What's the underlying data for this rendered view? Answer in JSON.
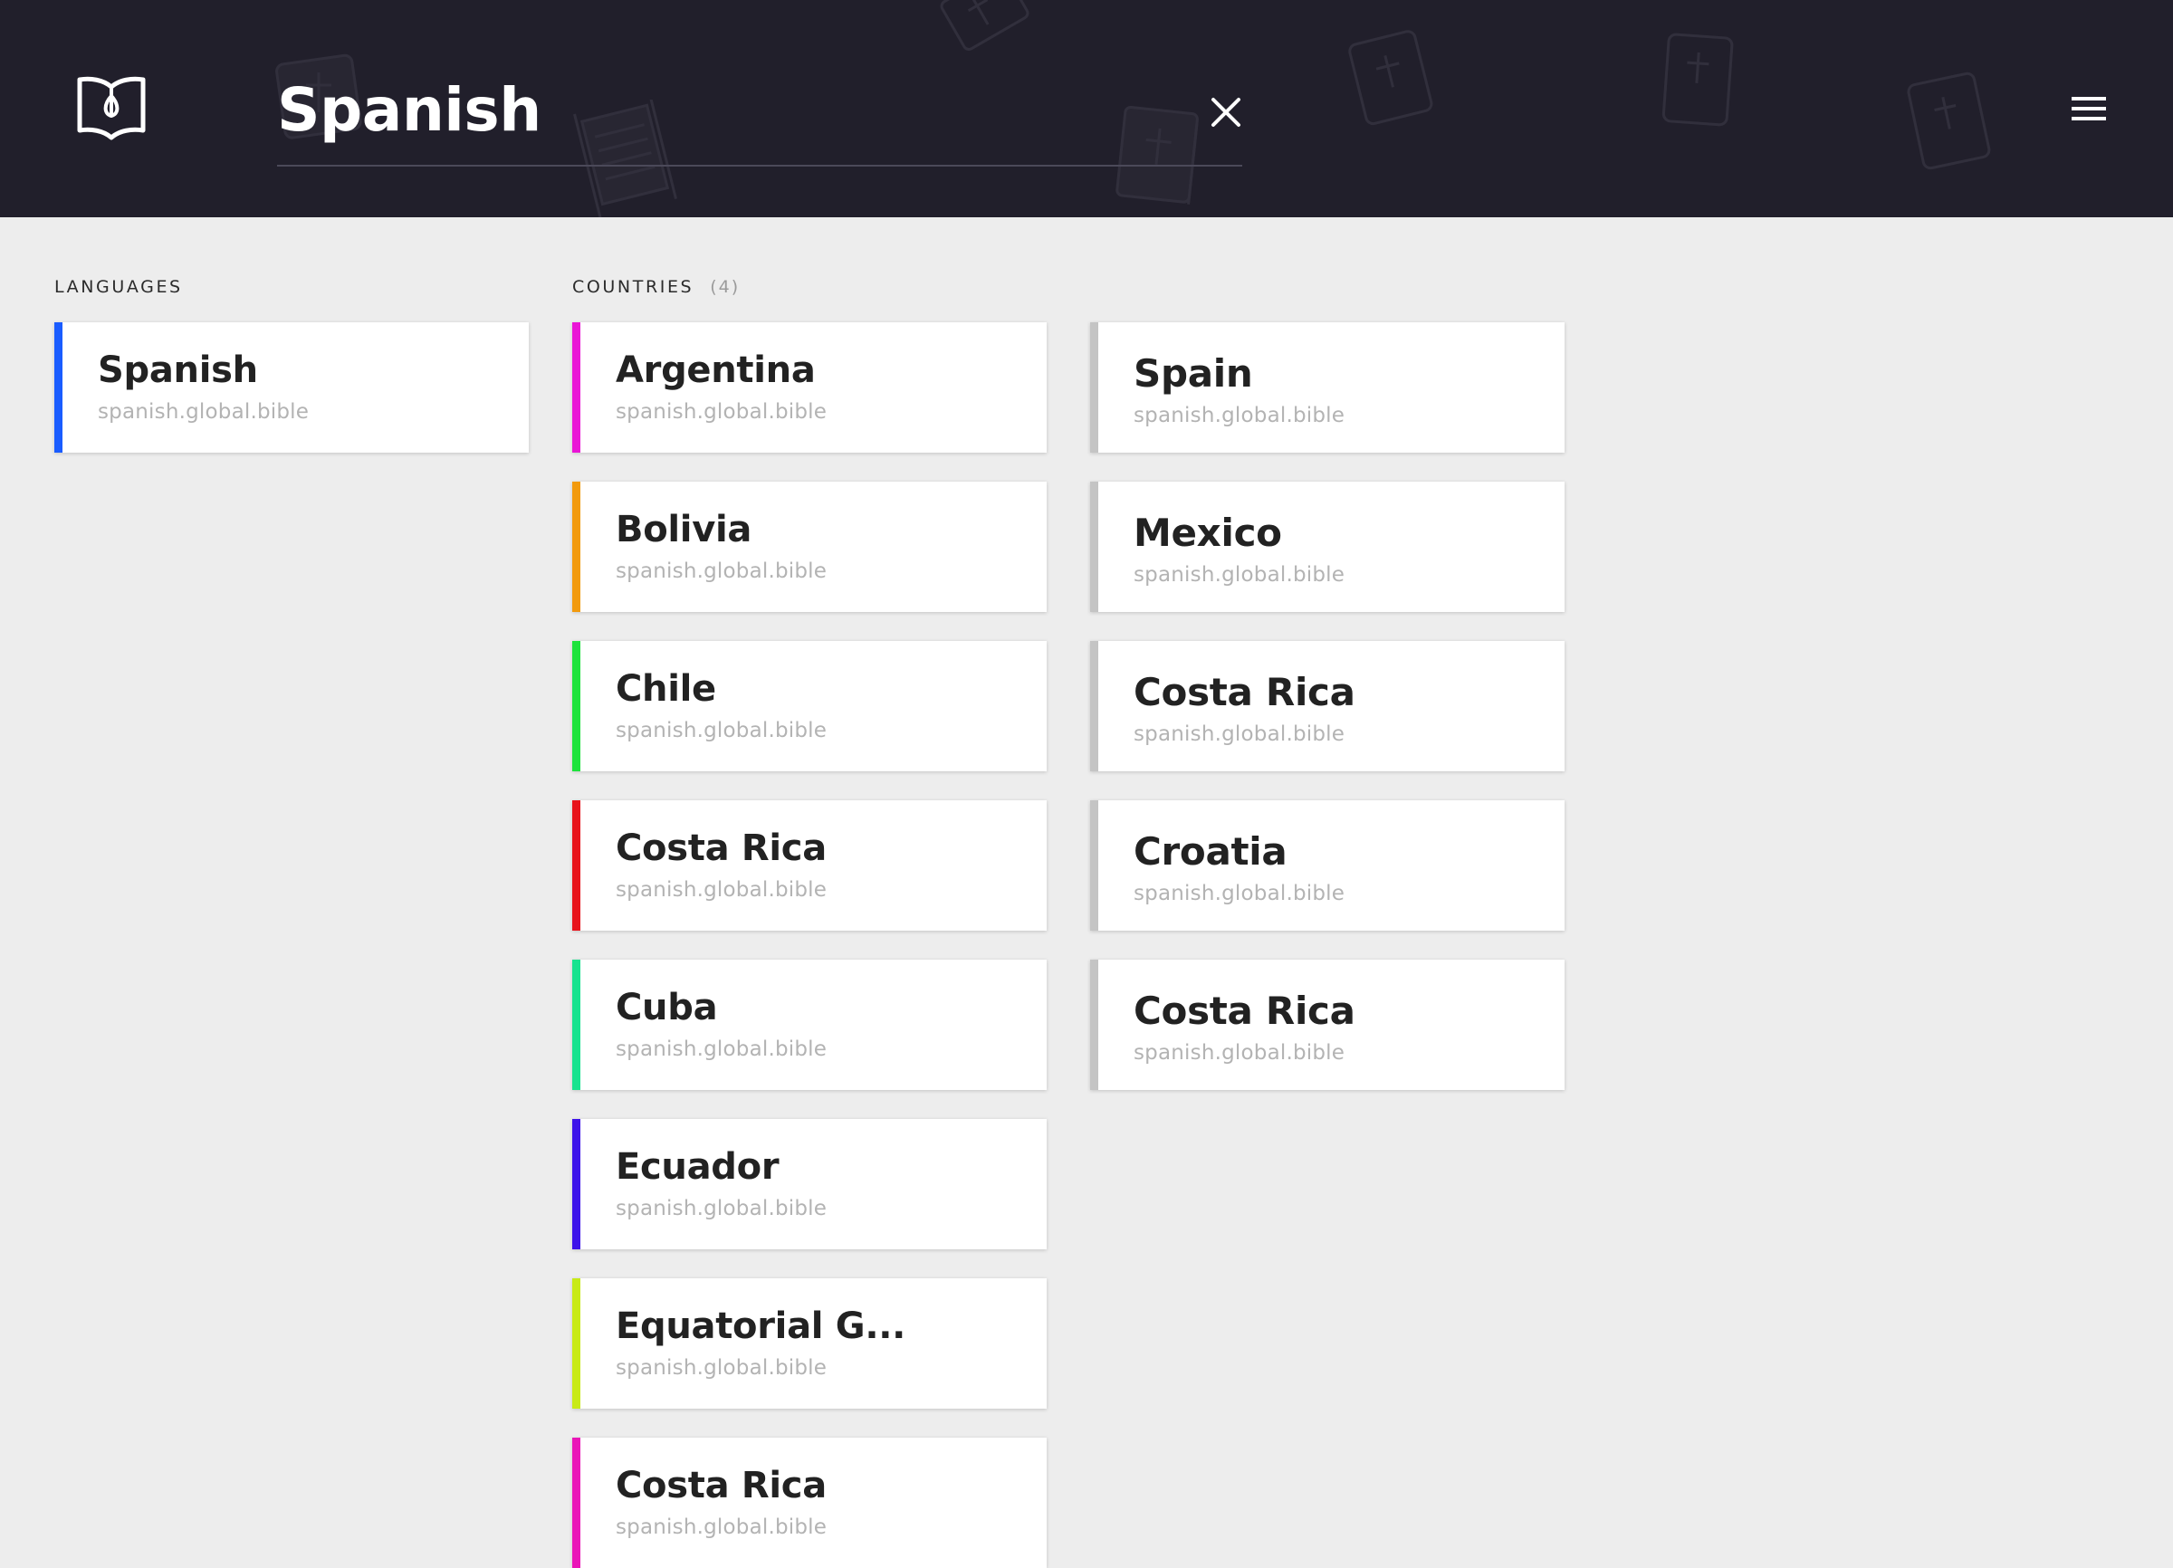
{
  "search": {
    "query": "Spanish"
  },
  "icons": {
    "logo": "open-book-logo-icon",
    "clear": "close-icon",
    "menu": "hamburger-menu-icon"
  },
  "colors": {
    "header_bg": "#211f2b",
    "page_bg": "#ededed",
    "language_accent": "#1a5cff",
    "neutral_accent": "#c4c4c4"
  },
  "languages": {
    "label": "LANGUAGES",
    "items": [
      {
        "name": "Spanish",
        "url": "spanish.global.bible",
        "color": "#1a5cff"
      }
    ]
  },
  "countries": {
    "label": "COUNTRIES",
    "count": "(4)",
    "column1": [
      {
        "name": "Argentina",
        "url": "spanish.global.bible",
        "color": "#ea15d6"
      },
      {
        "name": "Bolivia",
        "url": "spanish.global.bible",
        "color": "#f29a0d"
      },
      {
        "name": "Chile",
        "url": "spanish.global.bible",
        "color": "#1de33c"
      },
      {
        "name": "Costa Rica",
        "url": "spanish.global.bible",
        "color": "#e8121b"
      },
      {
        "name": "Cuba",
        "url": "spanish.global.bible",
        "color": "#17e38f"
      },
      {
        "name": "Ecuador",
        "url": "spanish.global.bible",
        "color": "#3d12ea"
      },
      {
        "name": "Equatorial G...",
        "url": "spanish.global.bible",
        "color": "#c8ea16"
      },
      {
        "name": "Costa Rica",
        "url": "spanish.global.bible",
        "color": "#ea15b8"
      }
    ],
    "column2": [
      {
        "name": "Spain",
        "url": "spanish.global.bible",
        "color": "#c4c4c4"
      },
      {
        "name": "Mexico",
        "url": "spanish.global.bible",
        "color": "#c4c4c4"
      },
      {
        "name": "Costa Rica",
        "url": "spanish.global.bible",
        "color": "#c4c4c4"
      },
      {
        "name": "Croatia",
        "url": "spanish.global.bible",
        "color": "#c4c4c4"
      },
      {
        "name": "Costa Rica",
        "url": "spanish.global.bible",
        "color": "#c4c4c4"
      }
    ]
  }
}
